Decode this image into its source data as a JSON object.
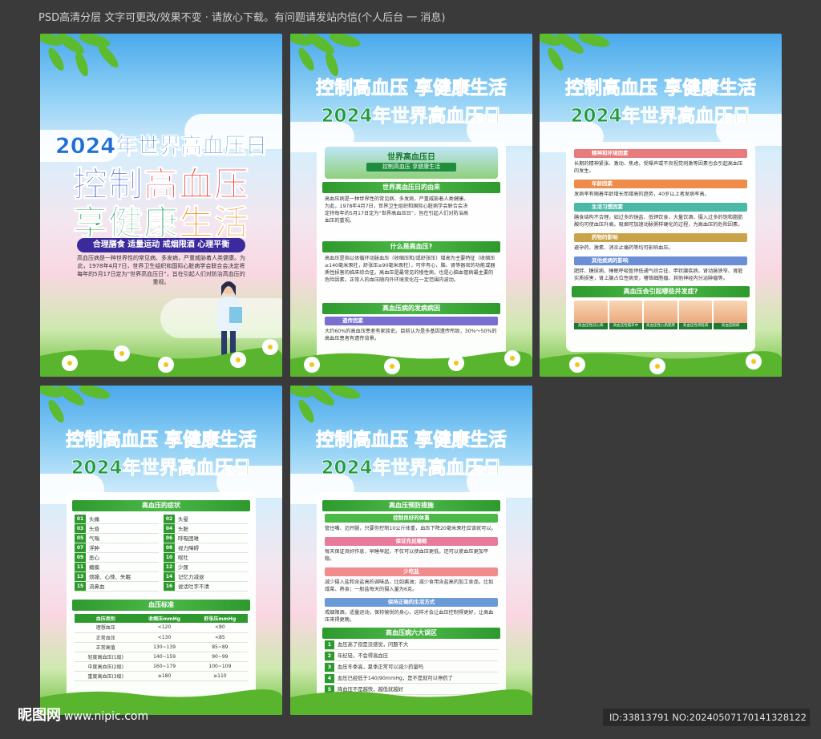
{
  "topbar_text": "PSD高清分层 文字可更改/效果不变 · 请放心下载。有问题请发站内信(个人后台 一 消息)",
  "poster1": {
    "year_title": "2024年世界高血压日",
    "big1": [
      "控制",
      "高血压"
    ],
    "big2": [
      "享健康",
      "生活"
    ],
    "slogan": "合理膳食 适量运动 戒烟限酒 心理平衡",
    "intro": "高血压病是一种世界性的常见病、多发病，严重威胁着人类健康。为此，1978年4月7日，世界卫生组织和国际心脏病学会联合会决定将每年的5月17日定为“世界高血压日”，旨在引起人们对防治高血压的重视。"
  },
  "header": {
    "line1_a": "控制高血压 ",
    "line1_b": "享健康",
    "line1_c": "生活",
    "line2": "2024年世界高血压日"
  },
  "poster2": {
    "banner_title": "世界高血压日",
    "banner_sub": "控制高血压 享健康生活",
    "sec1": "世界高血压日的由来",
    "sec1_text": "高血压病是一种世界性的常见病、多发病，严重威胁着人类健康。为此，1978年4月7日，世界卫生组织和国际心脏病学会联合会决定将每年的5月17日定为“世界高血压日”，旨在引起人们对防治高血压的重视。",
    "sec2": "什么是高血压?",
    "sec2_text": "高血压是指以体循环动脉血压（收缩压和/或舒张压）增高为主要特征（收缩压≥140毫米汞柱，舒张压≥90毫米汞柱），可伴有心、脑、肾等器官的功能或器质性损害的临床综合征。高血压是最常见的慢性病，也是心脑血管病最主要的危险因素。正常人的血压随内外环境变化在一定范围内波动。",
    "sec3": "高血压病的发病病因",
    "sub1": "遗传因素",
    "sub1_text": "大约60%的高血压患者有家族史。目前认为是多基因遗传所致，30%～50%的高血压患者有遗传背景。"
  },
  "poster3": {
    "items": [
      {
        "title": "精神和环境因素",
        "text": "长期的精神紧张、激动、焦虑，受噪声或不良视觉刺激等因素也会引起高血压的发生。",
        "color": "#e87b7b"
      },
      {
        "title": "年龄因素",
        "text": "发病率有随着年龄增长而增高的趋势，40岁以上者发病率高。",
        "color": "#f08c4a"
      },
      {
        "title": "生活习惯因素",
        "text": "膳食结构不合理，如过多的钠盐、低钾饮食、大量饮酒、摄入过多的饱和脂肪酸均可使血压升高。吸烟可加速动脉粥样硬化的过程，为高血压的危险因素。",
        "color": "#4cb8a8"
      },
      {
        "title": "药物的影响",
        "text": "避孕药、激素、消炎止痛药等均可影响血压。",
        "color": "#c9a24a"
      },
      {
        "title": "其他疾病的影响",
        "text": "肥胖、糖尿病、睡眠呼吸暂停低通气综合征、甲状腺疾病、肾动脉狭窄、肾脏实质损害，肾上腺占位性病变，嗜铬细胞瘤、其他神经内分泌肿瘤等。",
        "color": "#6b8fd6"
      }
    ],
    "complication_title": "高血压会引起哪些并发症?",
    "complications": [
      "高血压性冠心病",
      "高血压性脑卒中",
      "高血压性心肌肥厚",
      "高血压性肾脏病",
      "高血压眼病"
    ]
  },
  "poster4": {
    "symptoms_title": "高血压的症状",
    "symptoms": [
      {
        "n": "01",
        "t": "头痛"
      },
      {
        "n": "02",
        "t": "头晕"
      },
      {
        "n": "03",
        "t": "头昏"
      },
      {
        "n": "04",
        "t": "头胀"
      },
      {
        "n": "05",
        "t": "气喘"
      },
      {
        "n": "06",
        "t": "呼吸困难"
      },
      {
        "n": "07",
        "t": "浮肿"
      },
      {
        "n": "08",
        "t": "视力障碍"
      },
      {
        "n": "09",
        "t": "恶心"
      },
      {
        "n": "10",
        "t": "呕吐"
      },
      {
        "n": "11",
        "t": "瘫痪"
      },
      {
        "n": "12",
        "t": "少尿"
      },
      {
        "n": "13",
        "t": "烦躁、心悸、失眠"
      },
      {
        "n": "14",
        "t": "记忆力减退"
      },
      {
        "n": "15",
        "t": "流鼻血"
      },
      {
        "n": "16",
        "t": "说话吐字不清"
      }
    ],
    "bp_title": "血压标准",
    "bp_headers": [
      "血压类别",
      "收缩压mmHg",
      "舒张压mmHg"
    ],
    "bp_rows": [
      [
        "理想血压",
        "<120",
        "<80"
      ],
      [
        "正常血压",
        "<130",
        "<85"
      ],
      [
        "正常高值",
        "130~139",
        "85~89"
      ],
      [
        "轻度高血压(1级)",
        "140~159",
        "90~99"
      ],
      [
        "中度高血压(2级)",
        "160~179",
        "100~109"
      ],
      [
        "重度高血压(3级)",
        "≥180",
        "≥110"
      ]
    ]
  },
  "poster5": {
    "prev_title": "高血压预防措施",
    "measures": [
      {
        "title": "控制良好的体重",
        "text": "管住嘴、迈开腿，只要你控制10公斤体重，血压下降20毫米汞柱应该就可以。",
        "color": "#4cb848"
      },
      {
        "title": "保证充足睡眠",
        "text": "每天保证良好作息，早睡早起，不仅可以使血压更低，还可以使血压更加平稳。",
        "color": "#e87b9b"
      },
      {
        "title": "少吃盐",
        "text": "减少摄入盐和含盐高的调味品，比如酱油；减少食用含盐高的加工食品，比如咸菜、熟食；一般盐每天的摄入量为6克。",
        "color": "#f08c8c"
      },
      {
        "title": "保持正确的生活方式",
        "text": "戒烟限酒，适量运动，保持愉悦的身心，这样才会让血压控制得更好，让高血压来得更晚。",
        "color": "#6b9bd6"
      }
    ],
    "myth_title": "高血压病六大误区",
    "myths": [
      {
        "n": "1",
        "t": "血压高了但是没感觉，问题不大"
      },
      {
        "n": "2",
        "t": "年纪轻，不会得高血压"
      },
      {
        "n": "3",
        "t": "血压冬季高，夏季正常可以减少药量吗"
      },
      {
        "n": "4",
        "t": "血压已经低于140/90mmHg，是不是就可以停药了"
      },
      {
        "n": "5",
        "t": "降血压不是越快，越低就越好"
      },
      {
        "n": "6",
        "t": "没有高血压，还需要定期测量血压吗"
      }
    ]
  },
  "watermark_left": "昵图网",
  "watermark_left_url": "www.nipic.com",
  "watermark_right": "ID:33813791 NO:20240507170141328122"
}
